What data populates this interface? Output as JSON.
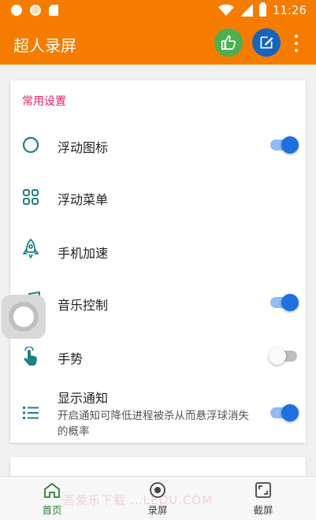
{
  "status_bar": {
    "time": "11:26"
  },
  "app_bar": {
    "title": "超人录屏",
    "like_button": "thumbs-up-icon",
    "edit_button": "edit-icon",
    "more_button": "more-vert-icon"
  },
  "settings": {
    "section_title": "常用设置",
    "items": [
      {
        "label": "浮动图标",
        "icon": "circle-outline-icon",
        "toggle": true
      },
      {
        "label": "浮动菜单",
        "icon": "grid-menu-icon"
      },
      {
        "label": "手机加速",
        "icon": "rocket-icon"
      },
      {
        "label": "音乐控制",
        "icon": "music-note-icon",
        "toggle": true
      },
      {
        "label": "手势",
        "icon": "gesture-hand-icon",
        "toggle": false
      },
      {
        "label": "显示通知",
        "icon": "list-icon",
        "toggle": true,
        "sublabel": "开启通知可降低进程被杀从而悬浮球消失的概率"
      }
    ]
  },
  "bottom_nav": {
    "items": [
      {
        "label": "首页",
        "icon": "home-icon",
        "active": true
      },
      {
        "label": "录屏",
        "icon": "record-icon",
        "active": false
      },
      {
        "label": "截屏",
        "icon": "screenshot-icon",
        "active": false
      }
    ]
  },
  "watermark": "吾爱乐下载 …LEDU.COM",
  "colors": {
    "app_bar": "#f57c00",
    "section_title": "#e91e63",
    "icon_teal": "#1e7f86",
    "switch_on": "#1e6fe0",
    "nav_active": "#2e7d32"
  }
}
